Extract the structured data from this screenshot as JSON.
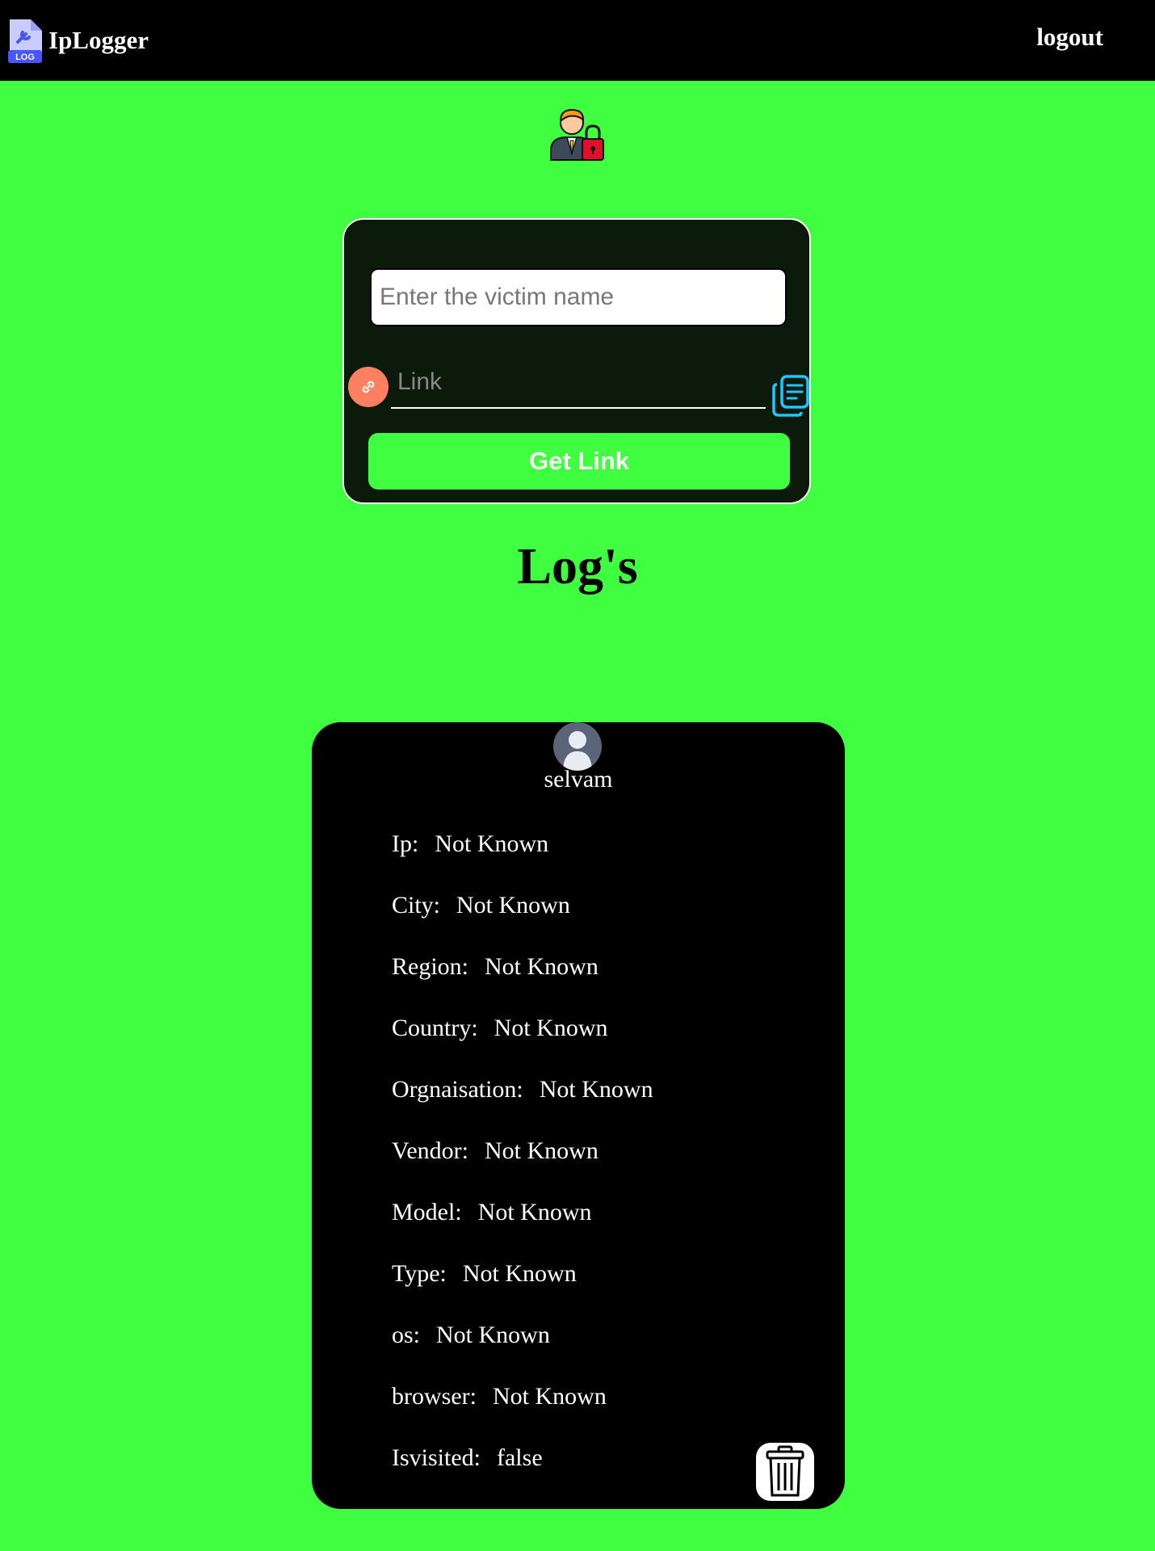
{
  "navbar": {
    "brand_logo_text": "LOG",
    "brand_name": "IpLogger",
    "logout_label": "logout"
  },
  "form": {
    "name_placeholder": "Enter the victim name",
    "link_placeholder": "Link",
    "get_link_label": "Get Link"
  },
  "logs": {
    "title": "Log's",
    "entry": {
      "name": "selvam",
      "fields": [
        {
          "label": "Ip:",
          "value": "Not Known"
        },
        {
          "label": "City:",
          "value": "Not Known"
        },
        {
          "label": "Region:",
          "value": "Not Known"
        },
        {
          "label": "Country:",
          "value": "Not Known"
        },
        {
          "label": "Orgnaisation:",
          "value": "Not Known"
        },
        {
          "label": "Vendor:",
          "value": "Not Known"
        },
        {
          "label": "Model:",
          "value": "Not Known"
        },
        {
          "label": "Type:",
          "value": "Not Known"
        },
        {
          "label": "os:",
          "value": "Not Known"
        },
        {
          "label": "browser:",
          "value": "Not Known"
        },
        {
          "label": "Isvisited:",
          "value": "false"
        }
      ]
    }
  },
  "icons": {
    "brand": "log-file-wrench-icon",
    "hero": "user-lock-icon",
    "link": "link-icon",
    "copy": "copy-icon",
    "avatar": "user-avatar-icon",
    "delete": "trash-icon"
  },
  "colors": {
    "background": "#40ff40",
    "navbar": "#000000",
    "card": "#000000",
    "form_card": "#0b1a0b",
    "button": "#40ff40",
    "link_icon_bg": "#ff8060",
    "copy_icon": "#1ec8ff"
  }
}
